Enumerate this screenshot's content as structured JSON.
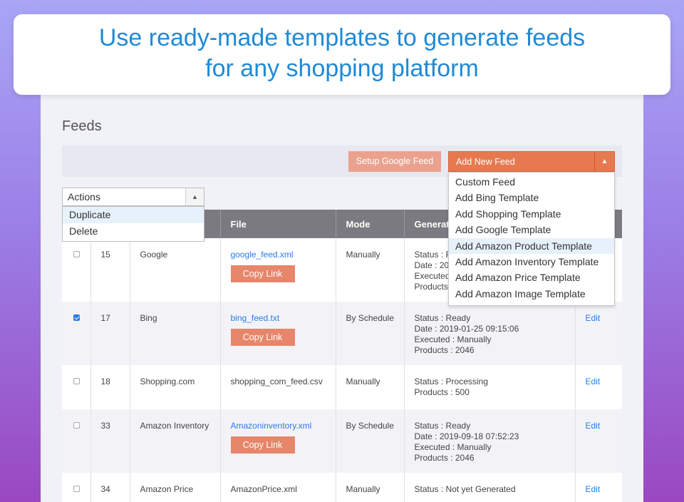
{
  "banner": {
    "line1": "Use ready-made templates to generate feeds",
    "line2": "for any shopping platform"
  },
  "page_title": "Feeds",
  "toolbar": {
    "setup_google_label": "Setup Google Feed",
    "add_new_label": "Add New Feed",
    "add_new_menu": [
      "Custom Feed",
      "Add Bing Template",
      "Add Shopping Template",
      "Add Google Template",
      "Add Amazon Product Template",
      "Add Amazon Inventory Template",
      "Add Amazon Price Template",
      "Add Amazon Image Template"
    ],
    "add_new_highlighted": "Add Amazon Product Template"
  },
  "actions": {
    "selected": "Actions",
    "options": [
      "Duplicate",
      "Delete"
    ],
    "highlighted": "Duplicate"
  },
  "table": {
    "columns": [
      "",
      "",
      "",
      "File",
      "Mode",
      "Generat",
      ""
    ],
    "copy_link_label": "Copy Link",
    "edit_label": "Edit",
    "rows": [
      {
        "id": "15",
        "name": "Google",
        "file": "google_feed.xml",
        "file_link": true,
        "copy": true,
        "mode": "Manually",
        "checked": false,
        "gen": [
          "Status : R",
          "Date : 20",
          "Executed",
          "Products"
        ],
        "edit": ""
      },
      {
        "id": "17",
        "name": "Bing",
        "file": "bing_feed.txt",
        "file_link": true,
        "copy": true,
        "mode": "By Schedule",
        "checked": true,
        "gen": [
          "Status : Ready",
          "Date : 2019-01-25 09:15:06",
          "Executed : Manually",
          "Products : 2046"
        ],
        "edit": "Edit"
      },
      {
        "id": "18",
        "name": "Shopping.com",
        "file": "shopping_com_feed.csv",
        "file_link": false,
        "copy": false,
        "mode": "Manually",
        "checked": false,
        "gen": [
          "Status : Processing",
          "Products : 500"
        ],
        "edit": "Edit"
      },
      {
        "id": "33",
        "name": "Amazon Inventory",
        "file": "Amazoninventory.xml",
        "file_link": true,
        "copy": true,
        "mode": "By Schedule",
        "checked": false,
        "gen": [
          "Status : Ready",
          "Date : 2019-09-18 07:52:23",
          "Executed : Manually",
          "Products : 2046"
        ],
        "edit": "Edit"
      },
      {
        "id": "34",
        "name": "Amazon Price",
        "file": "AmazonPrice.xml",
        "file_link": false,
        "copy": false,
        "mode": "Manually",
        "checked": false,
        "gen": [
          "Status : Not yet Generated"
        ],
        "edit": "Edit"
      }
    ]
  },
  "colors": {
    "accent": "#1f8ad6",
    "header_bg": "#7b7a80",
    "add_new_bg": "#e6794f",
    "copy_link_bg": "#e6866a"
  }
}
